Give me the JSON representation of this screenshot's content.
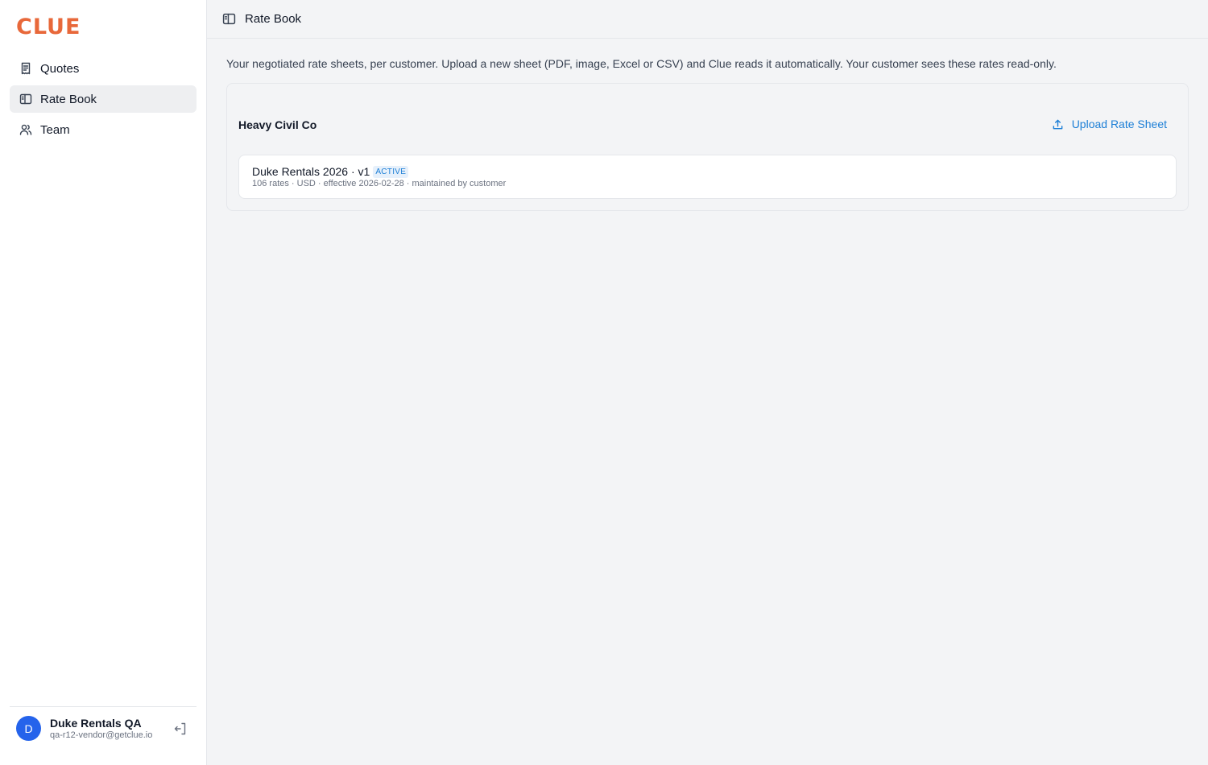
{
  "app": {
    "logo": "CLUE",
    "brand_color": "#e8683a",
    "accent_color": "#1d7fd6"
  },
  "sidebar": {
    "items": [
      {
        "label": "Quotes",
        "icon": "receipt-icon",
        "active": false
      },
      {
        "label": "Rate Book",
        "icon": "book-open-icon",
        "active": true
      },
      {
        "label": "Team",
        "icon": "users-icon",
        "active": false
      }
    ]
  },
  "user": {
    "initial": "D",
    "name": "Duke Rentals QA",
    "email": "qa-r12-vendor@getclue.io",
    "logout_icon": "logout-icon"
  },
  "header": {
    "title": "Rate Book",
    "icon": "book-open-icon"
  },
  "main": {
    "description": "Your negotiated rate sheets, per customer. Upload a new sheet (PDF, image, Excel or CSV) and Clue reads it automatically. Your customer sees these rates read-only.",
    "customers": [
      {
        "name": "Heavy Civil Co",
        "upload_label": "Upload Rate Sheet",
        "upload_icon": "upload-icon",
        "sheets": [
          {
            "title": "Duke Rentals 2026 · v1",
            "status": "ACTIVE",
            "meta": "106 rates · USD · effective 2026-02-28 · maintained by customer"
          }
        ]
      }
    ]
  }
}
